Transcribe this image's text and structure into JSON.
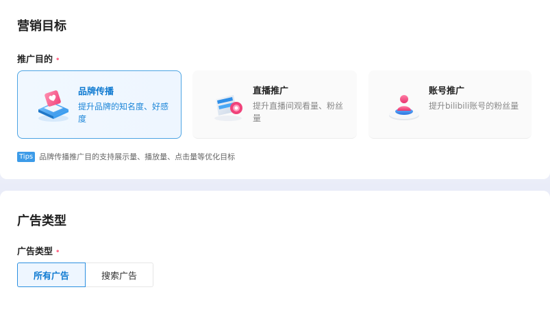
{
  "marketing": {
    "title": "营销目标",
    "field_label": "推广目的",
    "required_mark": "•",
    "options": [
      {
        "title": "品牌传播",
        "desc": "提升品牌的知名度、好感度",
        "icon": "brand-heart-box-icon",
        "selected": true
      },
      {
        "title": "直播推广",
        "desc": "提升直播间观看量、粉丝量",
        "icon": "live-camera-icon",
        "selected": false
      },
      {
        "title": "账号推广",
        "desc": "提升bilibili账号的粉丝量",
        "icon": "account-user-icon",
        "selected": false
      }
    ],
    "tips_badge": "Tips",
    "tips_text": "品牌传播推广目的支持展示量、播放量、点击量等优化目标"
  },
  "ad_type": {
    "title": "广告类型",
    "field_label": "广告类型",
    "required_mark": "•",
    "options": [
      {
        "label": "所有广告",
        "selected": true
      },
      {
        "label": "搜索广告",
        "selected": false
      }
    ]
  },
  "colors": {
    "accent": "#0f7ad1",
    "selected_border": "#4aa3e3",
    "required": "#ff6b8a"
  }
}
